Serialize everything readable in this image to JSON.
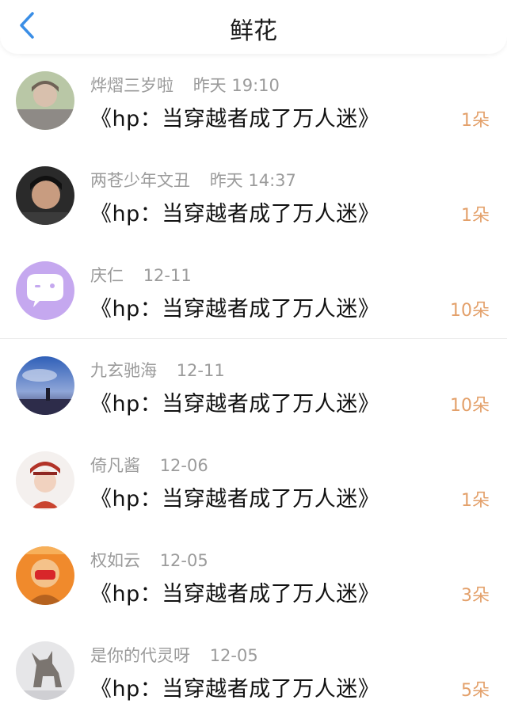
{
  "header": {
    "title": "鲜花",
    "back_icon": "chevron-left-icon",
    "accent": "#3a8ee6"
  },
  "items": [
    {
      "name": "烨熠三岁啦",
      "time": "昨天 19:10",
      "book": "《hp：当穿越者成了万人迷》",
      "count": "1朵",
      "avatar": "avatar-photo-young-man-outdoors"
    },
    {
      "name": "两苍少年文丑",
      "time": "昨天 14:37",
      "book": "《hp：当穿越者成了万人迷》",
      "count": "1朵",
      "avatar": "avatar-photo-boy-portrait"
    },
    {
      "name": "庆仁",
      "time": "12-11",
      "book": "《hp：当穿越者成了万人迷》",
      "count": "10朵",
      "avatar": "avatar-default-purple-chat"
    },
    {
      "name": "九玄驰海",
      "time": "12-11",
      "book": "《hp：当穿越者成了万人迷》",
      "count": "10朵",
      "avatar": "avatar-night-sky-scene"
    },
    {
      "name": "倚凡酱",
      "time": "12-06",
      "book": "《hp：当穿越者成了万人迷》",
      "count": "1朵",
      "avatar": "avatar-anime-boy-red-hat"
    },
    {
      "name": "权如云",
      "time": "12-05",
      "book": "《hp：当穿越者成了万人迷》",
      "count": "3朵",
      "avatar": "avatar-masked-character-orange"
    },
    {
      "name": "是你的代灵呀",
      "time": "12-05",
      "book": "《hp：当穿越者成了万人迷》",
      "count": "5朵",
      "avatar": "avatar-howling-wolf"
    }
  ],
  "colors": {
    "meta_text": "#9b9b9b",
    "count_text": "#e3a06a",
    "divider": "#f0f0f0"
  }
}
